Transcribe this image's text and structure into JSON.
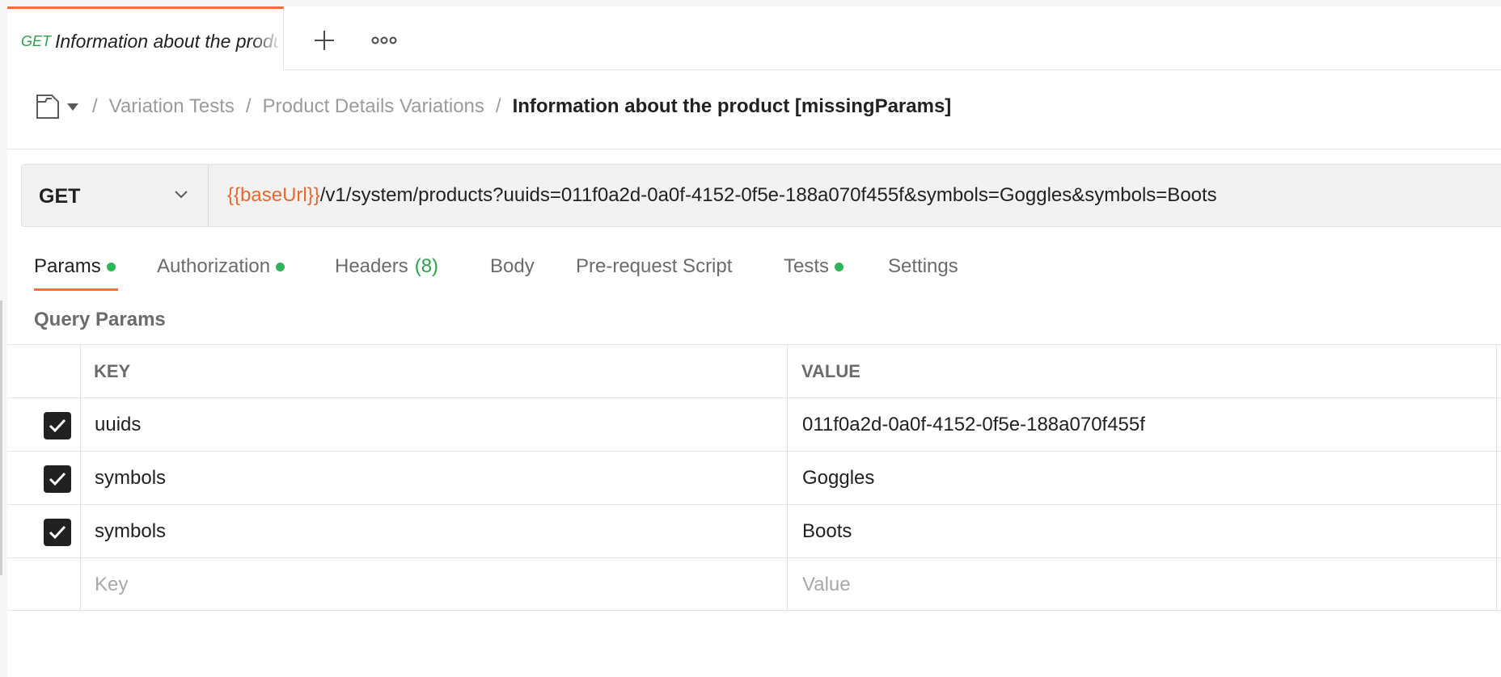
{
  "tab": {
    "method": "GET",
    "title": "Information about the product [missingParams]"
  },
  "breadcrumb": {
    "items": [
      "Variation Tests",
      "Product Details Variations"
    ],
    "current": "Information about the product [missingParams]",
    "separator": "/"
  },
  "request": {
    "method": "GET",
    "url_var": "{{baseUrl}}",
    "url_rest": "/v1/system/products?uuids=011f0a2d-0a0f-4152-0f5e-188a070f455f&symbols=Goggles&symbols=Boots"
  },
  "request_tabs": [
    {
      "label": "Params",
      "dot": true,
      "active": true
    },
    {
      "label": "Authorization",
      "dot": true
    },
    {
      "label": "Headers",
      "count": "(8)"
    },
    {
      "label": "Body"
    },
    {
      "label": "Pre-request Script"
    },
    {
      "label": "Tests",
      "dot": true
    },
    {
      "label": "Settings"
    }
  ],
  "query_params": {
    "title": "Query Params",
    "headers": {
      "key": "KEY",
      "value": "VALUE"
    },
    "rows": [
      {
        "checked": true,
        "key": "uuids",
        "value": "011f0a2d-0a0f-4152-0f5e-188a070f455f"
      },
      {
        "checked": true,
        "key": "symbols",
        "value": "Goggles"
      },
      {
        "checked": true,
        "key": "symbols",
        "value": "Boots"
      }
    ],
    "placeholder": {
      "key": "Key",
      "value": "Value"
    }
  },
  "colors": {
    "accent": "#ff6c37",
    "get": "#2f9e4f",
    "var": "#e8682f",
    "dot": "#2fb55a"
  }
}
